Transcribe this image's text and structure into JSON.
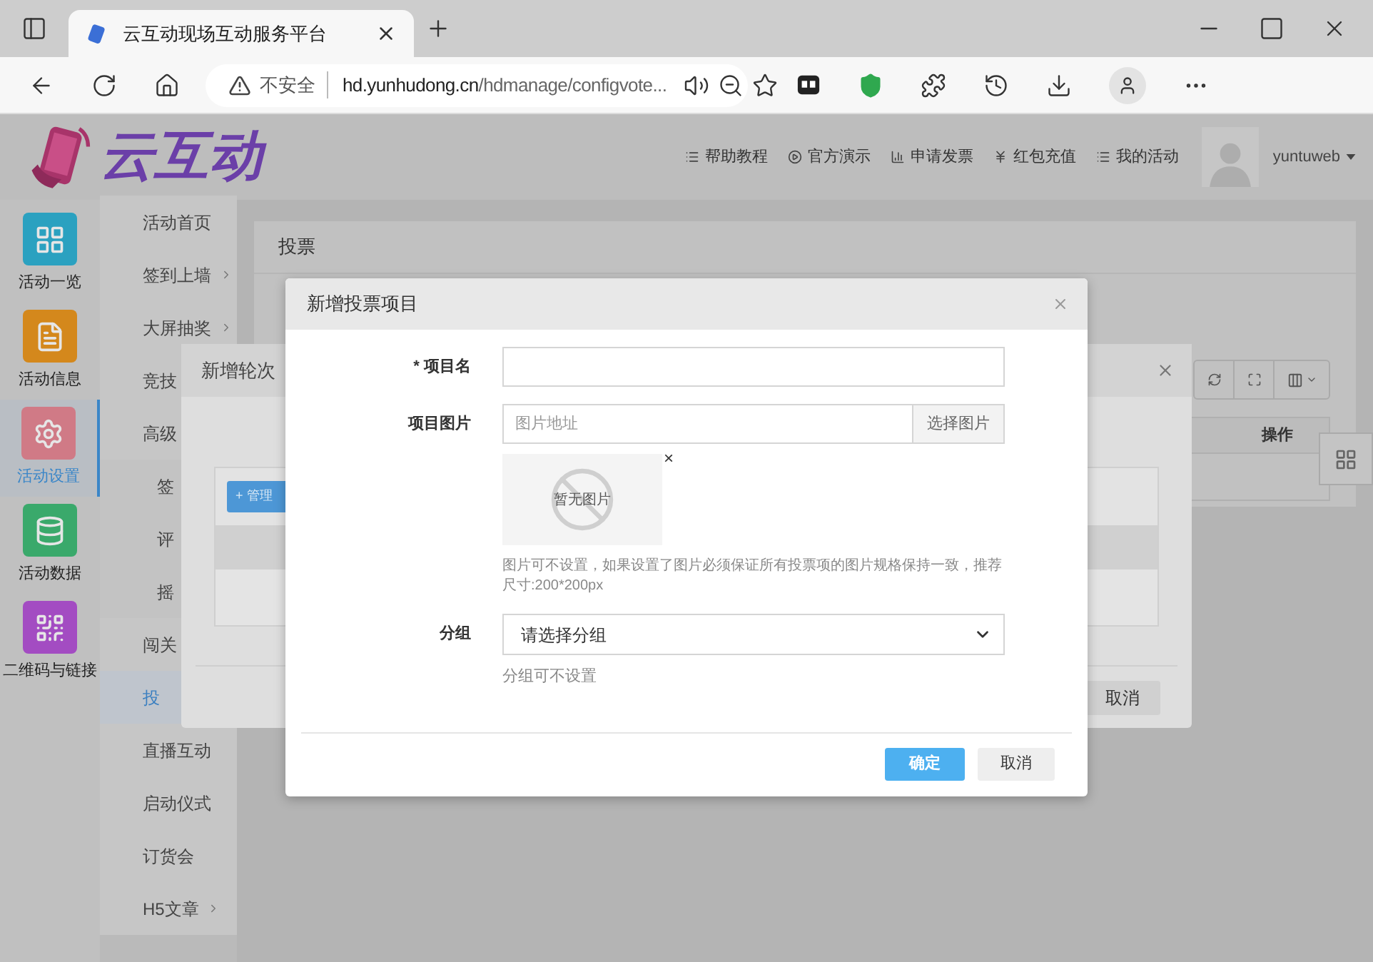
{
  "browser": {
    "tab_title": "云互动现场互动服务平台",
    "security": "不安全",
    "url_host": "hd.yunhudong.cn",
    "url_path": "/hdmanage/configvote..."
  },
  "header": {
    "logo": "云互动",
    "links": [
      {
        "kind": "list",
        "label": "帮助教程"
      },
      {
        "kind": "play",
        "label": "官方演示"
      },
      {
        "kind": "bars",
        "label": "申请发票"
      },
      {
        "kind": "yen",
        "label": "红包充值"
      },
      {
        "kind": "list",
        "label": "我的活动"
      }
    ],
    "user": "yuntuweb"
  },
  "sidebar": {
    "items": [
      {
        "kind": "grid",
        "label": "活动一览",
        "color": "#2ba1c0",
        "selected": false
      },
      {
        "kind": "doc",
        "label": "活动信息",
        "color": "#d4881c",
        "selected": false
      },
      {
        "kind": "gear",
        "label": "活动设置",
        "color": "#d07a86",
        "selected": true
      },
      {
        "kind": "database",
        "label": "活动数据",
        "color": "#3aa96b",
        "selected": false
      },
      {
        "kind": "qr",
        "label": "二维码与链接",
        "color": "#a34cc2",
        "selected": false
      }
    ]
  },
  "subnav": {
    "items": [
      {
        "label": "活动首页",
        "arrow": false,
        "selected": false
      },
      {
        "label": "签到上墙",
        "arrow": true,
        "selected": false
      },
      {
        "label": "大屏抽奖",
        "arrow": true,
        "selected": false
      },
      {
        "label": "竞技",
        "selected": false
      },
      {
        "label": "高级",
        "selected": false,
        "children": [
          {
            "label": "签",
            "selected": false
          },
          {
            "label": "评",
            "selected": false
          },
          {
            "label": "摇",
            "selected": false
          }
        ]
      },
      {
        "label": "闯关",
        "selected": false
      },
      {
        "label": "投",
        "arrow": false,
        "selected": true
      },
      {
        "label": "直播互动",
        "arrow": false,
        "selected": false
      },
      {
        "label": "启动仪式",
        "arrow": false,
        "selected": false
      },
      {
        "label": "订货会",
        "arrow": false,
        "selected": false
      },
      {
        "label": "H5文章",
        "arrow": true,
        "selected": false
      }
    ]
  },
  "panel": {
    "title": "投票",
    "table_header": "操作"
  },
  "round_dialog": {
    "title": "新增轮次",
    "add_button": "+ 管理",
    "cancel_button": "取消"
  },
  "vote_dialog": {
    "title": "新增投票项目",
    "fields": [
      {
        "kind": "text",
        "label": "* 项目名"
      },
      {
        "kind": "image",
        "label": "项目图片",
        "placeholder": "图片地址",
        "button": "选择图片",
        "preview_text": "暂无图片",
        "remove": "×",
        "hint": "图片可不设置，如果设置了图片必须保证所有投票项的图片规格保持一致，推荐尺寸:200*200px"
      },
      {
        "kind": "select",
        "label": "分组",
        "value": "请选择分组",
        "hint": "分组可不设置"
      }
    ],
    "confirm_button": "确定",
    "cancel_button": "取消"
  }
}
